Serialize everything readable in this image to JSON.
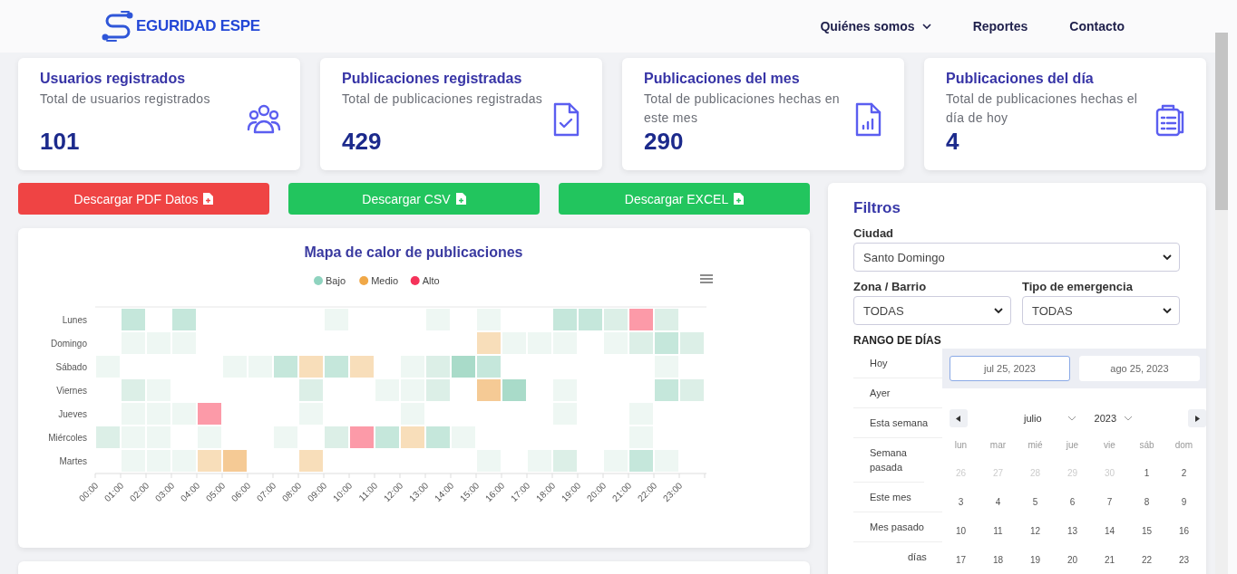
{
  "navbar": {
    "brand": "EGURIDAD ESPE",
    "links": [
      {
        "label": "Quiénes somos",
        "has_menu": true
      },
      {
        "label": "Reportes",
        "has_menu": false
      },
      {
        "label": "Contacto",
        "has_menu": false
      }
    ]
  },
  "stats": [
    {
      "title": "Usuarios registrados",
      "subtitle": "Total de usuarios registrados",
      "value": "101",
      "kind": "users"
    },
    {
      "title": "Publicaciones registradas",
      "subtitle": "Total de publicaciones registradas",
      "value": "429",
      "kind": "document-check"
    },
    {
      "title": "Publicaciones del mes",
      "subtitle": "Total de publicaciones hechas en este mes",
      "value": "290",
      "kind": "document-chart"
    },
    {
      "title": "Publicaciones del día",
      "subtitle": "Total de publicaciones hechas el día de hoy",
      "value": "4",
      "kind": "clipboard"
    }
  ],
  "downloads": [
    {
      "label": "Descargar PDF Datos",
      "color": "#ef4444"
    },
    {
      "label": "Descargar CSV",
      "color": "#22c55e"
    },
    {
      "label": "Descargar EXCEL",
      "color": "#22c55e"
    }
  ],
  "heatmap": {
    "title": "Mapa de calor de publicaciones",
    "legend": [
      {
        "label": "Bajo",
        "color": "#8fd3bf"
      },
      {
        "label": "Medio",
        "color": "#f0a848"
      },
      {
        "label": "Alto",
        "color": "#f5335a"
      }
    ],
    "hours": [
      "00:00",
      "01:00",
      "02:00",
      "03:00",
      "04:00",
      "05:00",
      "06:00",
      "07:00",
      "08:00",
      "09:00",
      "10:00",
      "11:00",
      "12:00",
      "13:00",
      "14:00",
      "15:00",
      "16:00",
      "17:00",
      "18:00",
      "19:00",
      "20:00",
      "21:00",
      "22:00",
      "23:00"
    ],
    "rows": [
      {
        "day": "Lunes",
        "cells": [
          {
            "kind": "none"
          },
          {
            "kind": "bajo",
            "color": "#c5e7db"
          },
          {
            "kind": "none"
          },
          {
            "kind": "bajo",
            "color": "#c5e7db"
          },
          {
            "kind": "none"
          },
          {
            "kind": "none"
          },
          {
            "kind": "none"
          },
          {
            "kind": "none"
          },
          {
            "kind": "none"
          },
          {
            "kind": "bajo",
            "color": "#eef7f3"
          },
          {
            "kind": "none"
          },
          {
            "kind": "none"
          },
          {
            "kind": "none"
          },
          {
            "kind": "bajo",
            "color": "#eef7f3"
          },
          {
            "kind": "none"
          },
          {
            "kind": "bajo",
            "color": "#eef7f3"
          },
          {
            "kind": "none"
          },
          {
            "kind": "none"
          },
          {
            "kind": "bajo",
            "color": "#c5e7db"
          },
          {
            "kind": "bajo",
            "color": "#c5e7db"
          },
          {
            "kind": "bajo",
            "color": "#dcefe7"
          },
          {
            "kind": "alto",
            "color": "#fc9aa8"
          },
          {
            "kind": "bajo",
            "color": "#dcefe7"
          },
          {
            "kind": "none"
          }
        ]
      },
      {
        "day": "Domingo",
        "cells": [
          {
            "kind": "none"
          },
          {
            "kind": "bajo",
            "color": "#eef7f3"
          },
          {
            "kind": "bajo",
            "color": "#eef7f3"
          },
          {
            "kind": "bajo",
            "color": "#eef7f3"
          },
          {
            "kind": "none"
          },
          {
            "kind": "none"
          },
          {
            "kind": "none"
          },
          {
            "kind": "none"
          },
          {
            "kind": "none"
          },
          {
            "kind": "none"
          },
          {
            "kind": "none"
          },
          {
            "kind": "none"
          },
          {
            "kind": "none"
          },
          {
            "kind": "none"
          },
          {
            "kind": "none"
          },
          {
            "kind": "medio",
            "color": "#f8deba"
          },
          {
            "kind": "bajo",
            "color": "#eef7f3"
          },
          {
            "kind": "bajo",
            "color": "#eef7f3"
          },
          {
            "kind": "bajo",
            "color": "#eef7f3"
          },
          {
            "kind": "none"
          },
          {
            "kind": "bajo",
            "color": "#eef7f3"
          },
          {
            "kind": "bajo",
            "color": "#dcefe7"
          },
          {
            "kind": "bajo",
            "color": "#c5e7db"
          },
          {
            "kind": "bajo",
            "color": "#dcefe7"
          }
        ]
      },
      {
        "day": "Sábado",
        "cells": [
          {
            "kind": "bajo",
            "color": "#eef7f3"
          },
          {
            "kind": "none"
          },
          {
            "kind": "none"
          },
          {
            "kind": "none"
          },
          {
            "kind": "none"
          },
          {
            "kind": "bajo",
            "color": "#eef7f3"
          },
          {
            "kind": "bajo",
            "color": "#eef7f3"
          },
          {
            "kind": "bajo",
            "color": "#c5e7db"
          },
          {
            "kind": "medio",
            "color": "#f8deba"
          },
          {
            "kind": "bajo",
            "color": "#c5e7db"
          },
          {
            "kind": "medio",
            "color": "#f8deba"
          },
          {
            "kind": "none"
          },
          {
            "kind": "bajo",
            "color": "#eef7f3"
          },
          {
            "kind": "bajo",
            "color": "#dcefe7"
          },
          {
            "kind": "bajo",
            "color": "#a9dbc9"
          },
          {
            "kind": "bajo",
            "color": "#c5e7db"
          },
          {
            "kind": "none"
          },
          {
            "kind": "none"
          },
          {
            "kind": "none"
          },
          {
            "kind": "none"
          },
          {
            "kind": "none"
          },
          {
            "kind": "none"
          },
          {
            "kind": "bajo",
            "color": "#eef7f3"
          },
          {
            "kind": "none"
          }
        ]
      },
      {
        "day": "Viernes",
        "cells": [
          {
            "kind": "none"
          },
          {
            "kind": "bajo",
            "color": "#dcefe7"
          },
          {
            "kind": "bajo",
            "color": "#eef7f3"
          },
          {
            "kind": "none"
          },
          {
            "kind": "none"
          },
          {
            "kind": "none"
          },
          {
            "kind": "none"
          },
          {
            "kind": "none"
          },
          {
            "kind": "bajo",
            "color": "#dcefe7"
          },
          {
            "kind": "none"
          },
          {
            "kind": "none"
          },
          {
            "kind": "bajo",
            "color": "#eef7f3"
          },
          {
            "kind": "bajo",
            "color": "#eef7f3"
          },
          {
            "kind": "bajo",
            "color": "#dcefe7"
          },
          {
            "kind": "none"
          },
          {
            "kind": "medio",
            "color": "#f5ca95"
          },
          {
            "kind": "bajo",
            "color": "#a9dbc9"
          },
          {
            "kind": "none"
          },
          {
            "kind": "bajo",
            "color": "#eef7f3"
          },
          {
            "kind": "none"
          },
          {
            "kind": "none"
          },
          {
            "kind": "none"
          },
          {
            "kind": "bajo",
            "color": "#c5e7db"
          },
          {
            "kind": "bajo",
            "color": "#dcefe7"
          }
        ]
      },
      {
        "day": "Jueves",
        "cells": [
          {
            "kind": "none"
          },
          {
            "kind": "bajo",
            "color": "#eef7f3"
          },
          {
            "kind": "bajo",
            "color": "#eef7f3"
          },
          {
            "kind": "bajo",
            "color": "#eef7f3"
          },
          {
            "kind": "alto",
            "color": "#fc9aa8"
          },
          {
            "kind": "none"
          },
          {
            "kind": "none"
          },
          {
            "kind": "none"
          },
          {
            "kind": "bajo",
            "color": "#eef7f3"
          },
          {
            "kind": "none"
          },
          {
            "kind": "none"
          },
          {
            "kind": "none"
          },
          {
            "kind": "bajo",
            "color": "#eef7f3"
          },
          {
            "kind": "none"
          },
          {
            "kind": "none"
          },
          {
            "kind": "none"
          },
          {
            "kind": "none"
          },
          {
            "kind": "none"
          },
          {
            "kind": "bajo",
            "color": "#eef7f3"
          },
          {
            "kind": "none"
          },
          {
            "kind": "none"
          },
          {
            "kind": "bajo",
            "color": "#eef7f3"
          },
          {
            "kind": "none"
          },
          {
            "kind": "none"
          }
        ]
      },
      {
        "day": "Miércoles",
        "cells": [
          {
            "kind": "bajo",
            "color": "#dcefe7"
          },
          {
            "kind": "bajo",
            "color": "#eef7f3"
          },
          {
            "kind": "bajo",
            "color": "#eef7f3"
          },
          {
            "kind": "none"
          },
          {
            "kind": "bajo",
            "color": "#eef7f3"
          },
          {
            "kind": "none"
          },
          {
            "kind": "none"
          },
          {
            "kind": "bajo",
            "color": "#eef7f3"
          },
          {
            "kind": "none"
          },
          {
            "kind": "bajo",
            "color": "#dcefe7"
          },
          {
            "kind": "alto",
            "color": "#fc9aa8"
          },
          {
            "kind": "bajo",
            "color": "#c5e7db"
          },
          {
            "kind": "medio",
            "color": "#f8deba"
          },
          {
            "kind": "bajo",
            "color": "#c5e7db"
          },
          {
            "kind": "bajo",
            "color": "#eef7f3"
          },
          {
            "kind": "none"
          },
          {
            "kind": "none"
          },
          {
            "kind": "none"
          },
          {
            "kind": "none"
          },
          {
            "kind": "none"
          },
          {
            "kind": "none"
          },
          {
            "kind": "bajo",
            "color": "#eef7f3"
          },
          {
            "kind": "none"
          },
          {
            "kind": "none"
          }
        ]
      },
      {
        "day": "Martes",
        "cells": [
          {
            "kind": "none"
          },
          {
            "kind": "bajo",
            "color": "#eef7f3"
          },
          {
            "kind": "bajo",
            "color": "#eef7f3"
          },
          {
            "kind": "bajo",
            "color": "#eef7f3"
          },
          {
            "kind": "medio",
            "color": "#f8deba"
          },
          {
            "kind": "medio",
            "color": "#f5ca95"
          },
          {
            "kind": "none"
          },
          {
            "kind": "none"
          },
          {
            "kind": "medio",
            "color": "#f8deba"
          },
          {
            "kind": "none"
          },
          {
            "kind": "none"
          },
          {
            "kind": "none"
          },
          {
            "kind": "none"
          },
          {
            "kind": "none"
          },
          {
            "kind": "none"
          },
          {
            "kind": "bajo",
            "color": "#eef7f3"
          },
          {
            "kind": "none"
          },
          {
            "kind": "bajo",
            "color": "#eef7f3"
          },
          {
            "kind": "bajo",
            "color": "#dcefe7"
          },
          {
            "kind": "none"
          },
          {
            "kind": "bajo",
            "color": "#eef7f3"
          },
          {
            "kind": "bajo",
            "color": "#c5e7db"
          },
          {
            "kind": "bajo",
            "color": "#eef7f3"
          },
          {
            "kind": "none"
          }
        ]
      }
    ]
  },
  "filters": {
    "title": "Filtros",
    "city": {
      "label": "Ciudad",
      "value": "Santo Domingo"
    },
    "zone": {
      "label": "Zona / Barrio",
      "value": "TODAS"
    },
    "emergency": {
      "label": "Tipo de emergencia",
      "value": "TODAS"
    },
    "range_label": "RANGO DE DÍAS",
    "presets": [
      "Hoy",
      "Ayer",
      "Esta semana",
      "Semana pasada",
      "Este mes",
      "Mes pasado",
      "días"
    ],
    "start_date": {
      "value": "jul 25, 2023",
      "selected": true
    },
    "end_date": {
      "value": "ago 25, 2023",
      "selected": false
    },
    "month": "julio",
    "year": "2023",
    "weekdays": [
      "lun",
      "mar",
      "mié",
      "jue",
      "vie",
      "sáb",
      "dom"
    ],
    "days": [
      {
        "label": "26",
        "muted": true
      },
      {
        "label": "27",
        "muted": true
      },
      {
        "label": "28",
        "muted": true
      },
      {
        "label": "29",
        "muted": true
      },
      {
        "label": "30",
        "muted": true
      },
      {
        "label": "1",
        "muted": false
      },
      {
        "label": "2",
        "muted": false
      },
      {
        "label": "3",
        "muted": false
      },
      {
        "label": "4",
        "muted": false
      },
      {
        "label": "5",
        "muted": false
      },
      {
        "label": "6",
        "muted": false
      },
      {
        "label": "7",
        "muted": false
      },
      {
        "label": "8",
        "muted": false
      },
      {
        "label": "9",
        "muted": false
      },
      {
        "label": "10",
        "muted": false
      },
      {
        "label": "11",
        "muted": false
      },
      {
        "label": "12",
        "muted": false
      },
      {
        "label": "13",
        "muted": false
      },
      {
        "label": "14",
        "muted": false
      },
      {
        "label": "15",
        "muted": false
      },
      {
        "label": "16",
        "muted": false
      },
      {
        "label": "17",
        "muted": false
      },
      {
        "label": "18",
        "muted": false
      },
      {
        "label": "19",
        "muted": false
      },
      {
        "label": "20",
        "muted": false
      },
      {
        "label": "21",
        "muted": false
      },
      {
        "label": "22",
        "muted": false
      },
      {
        "label": "23",
        "muted": false
      }
    ]
  }
}
